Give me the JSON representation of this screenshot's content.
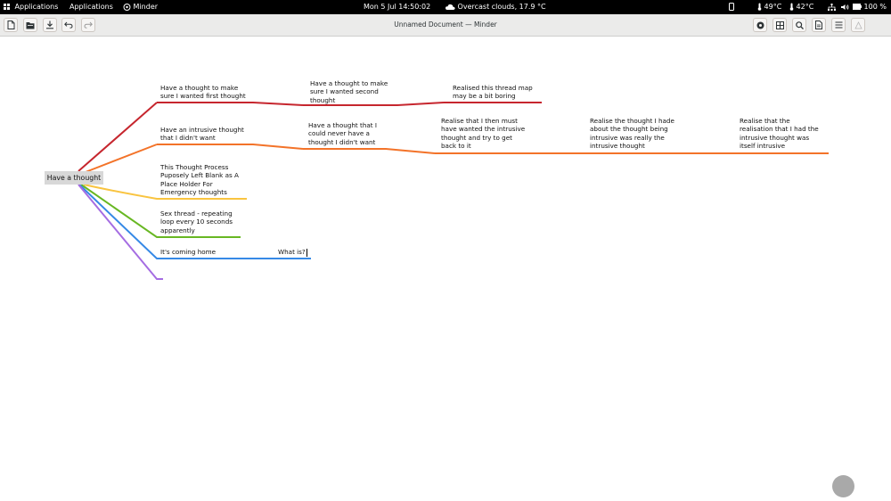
{
  "topbar": {
    "activities": "Applications",
    "applications_menu": "Applications",
    "app_name": "Minder",
    "datetime": "Mon 5 Jul  14:50:02",
    "weather": "Overcast clouds, 17.9 °C",
    "temp_cpu": "49°C",
    "temp_gpu": "42°C",
    "battery": "100 %"
  },
  "window": {
    "title": "Unnamed Document — Minder"
  },
  "mindmap": {
    "root": "Have a thought",
    "nodes": [
      {
        "id": "n1",
        "text": "Have a thought to make\nsure I wanted first thought",
        "color": "#c6262e"
      },
      {
        "id": "n2",
        "text": "Have a thought to make\nsure I wanted second\nthought",
        "color": "#c6262e"
      },
      {
        "id": "n3",
        "text": "Realised this thread map\nmay be a bit boring",
        "color": "#c6262e"
      },
      {
        "id": "n4",
        "text": "Have an intrusive thought\nthat I didn't want",
        "color": "#f37329"
      },
      {
        "id": "n5",
        "text": "Have a thought that I\ncould never have a\nthought I didn't want",
        "color": "#f37329"
      },
      {
        "id": "n6",
        "text": "Realise that I then must\nhave wanted the intrusive\nthought and try to get\nback to it",
        "color": "#f37329"
      },
      {
        "id": "n7",
        "text": "Realise the thought I hade\nabout the thought being\nintrusive was really the\nintrusive thought",
        "color": "#f37329"
      },
      {
        "id": "n8",
        "text": "Realise that the\nrealisation that I had the\nintrusive thought was\nitself intrusive",
        "color": "#f37329"
      },
      {
        "id": "n9",
        "text": "This Thought Process\nPuposely Left Blank as A\nPlace Holder For\nEmergency thoughts",
        "color": "#f9c440"
      },
      {
        "id": "n10",
        "text": "Sex thread - repeating\nloop every 10 seconds\napparently",
        "color": "#68b723"
      },
      {
        "id": "n11",
        "text": "It's coming home",
        "color": "#3689e6"
      },
      {
        "id": "n12",
        "text": "What is?",
        "color": "#3689e6"
      },
      {
        "id": "n13",
        "text": "",
        "color": "#a56de2"
      }
    ]
  },
  "icons": {
    "new": "new-document-icon",
    "open": "open-icon",
    "save": "save-icon",
    "undo": "undo-icon",
    "redo": "redo-icon",
    "sticker": "sticker-icon",
    "zoom": "zoom-icon",
    "search": "search-icon",
    "export": "export-icon",
    "menu": "menu-icon",
    "properties": "properties-icon"
  }
}
